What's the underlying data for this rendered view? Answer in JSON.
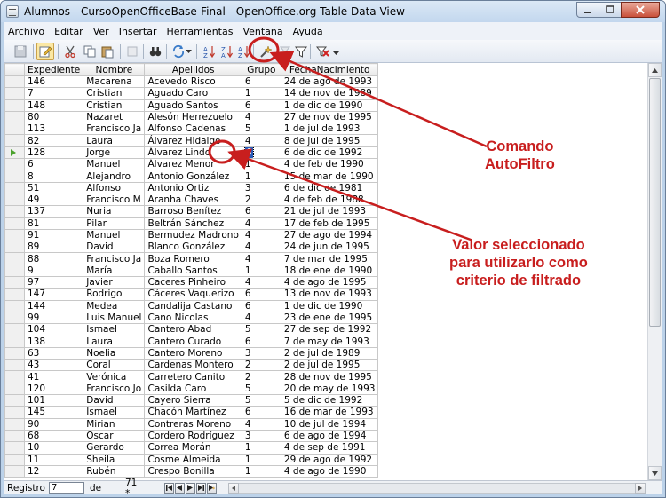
{
  "window": {
    "title": "Alumnos - CursoOpenOfficeBase-Final - OpenOffice.org Table Data View",
    "min": "0",
    "max": "1",
    "close": "r"
  },
  "menu": [
    {
      "u": "A",
      "rest": "rchivo"
    },
    {
      "u": "E",
      "rest": "ditar"
    },
    {
      "u": "V",
      "rest": "er"
    },
    {
      "u": "I",
      "rest": "nsertar"
    },
    {
      "u": "H",
      "rest": "erramientas"
    },
    {
      "u": "V",
      "rest": "entana"
    },
    {
      "u": "Ay",
      "rest": "uda"
    }
  ],
  "columns": [
    "Expediente",
    "Nombre",
    "Apellidos",
    "Grupo",
    "FechaNacimiento"
  ],
  "rows": [
    [
      "146",
      "Macarena",
      "Acevedo Risco",
      "6",
      "24 de ago de 1993"
    ],
    [
      "7",
      "Cristian",
      "Aguado Caro",
      "1",
      "14 de nov de 1989"
    ],
    [
      "148",
      "Cristian",
      "Aguado Santos",
      "6",
      "1 de dic de 1990"
    ],
    [
      "80",
      "Nazaret",
      "Alesón Herrezuelo",
      "4",
      "27 de nov de 1995"
    ],
    [
      "113",
      "Francisco Ja",
      "Alfonso Cadenas",
      "5",
      "1 de jul de 1993"
    ],
    [
      "82",
      "Laura",
      "Álvarez Hidalgo",
      "4",
      "8 de jul de 1995"
    ],
    [
      "128",
      "Jorge",
      "Álvarez Lindo",
      "6",
      "6 de dic de 1992"
    ],
    [
      "6",
      "Manuel",
      "Álvarez Menor",
      "1",
      "4 de feb de 1990"
    ],
    [
      "8",
      "Alejandro",
      "Antonio González",
      "1",
      "15 de mar de 1990"
    ],
    [
      "51",
      "Alfonso",
      "Antonio Ortiz",
      "3",
      "6 de dic de 1981"
    ],
    [
      "49",
      "Francisco M",
      "Aranha Chaves",
      "2",
      "4 de feb de 1988"
    ],
    [
      "137",
      "Nuria",
      "Barroso Benítez",
      "6",
      "21 de jul de 1993"
    ],
    [
      "81",
      "Pilar",
      "Beltrán Sánchez",
      "4",
      "17 de feb de 1995"
    ],
    [
      "91",
      "Manuel",
      "Bermudez Madrono",
      "4",
      "27 de ago de 1994"
    ],
    [
      "89",
      "David",
      "Blanco González",
      "4",
      "24 de jun de 1995"
    ],
    [
      "88",
      "Francisco Ja",
      "Boza Romero",
      "4",
      "7 de mar de 1995"
    ],
    [
      "9",
      "María",
      "Caballo Santos",
      "1",
      "18 de ene de 1990"
    ],
    [
      "97",
      "Javier",
      "Caceres Pinheiro",
      "4",
      "4 de ago de 1995"
    ],
    [
      "147",
      "Rodrigo",
      "Cáceres Vaquerizo",
      "6",
      "13 de nov de 1993"
    ],
    [
      "144",
      "Medea",
      "Candalija Castano",
      "6",
      "1 de dic de 1990"
    ],
    [
      "99",
      "Luis Manuel",
      "Cano Nicolas",
      "4",
      "23 de ene de 1995"
    ],
    [
      "104",
      "Ismael",
      "Cantero Abad",
      "5",
      "27 de sep de 1992"
    ],
    [
      "138",
      "Laura",
      "Cantero Curado",
      "6",
      "7 de may de 1993"
    ],
    [
      "63",
      "Noelia",
      "Cantero Moreno",
      "3",
      "2 de jul de 1989"
    ],
    [
      "43",
      "Coral",
      "Cardenas Montero",
      "2",
      "2 de jul de 1995"
    ],
    [
      "41",
      "Verónica",
      "Carretero Canito",
      "2",
      "28 de nov de 1995"
    ],
    [
      "120",
      "Francisco Jo",
      "Casilda Caro",
      "5",
      "20 de may de 1993"
    ],
    [
      "101",
      "David",
      "Cayero Sierra",
      "5",
      "5 de dic de 1992"
    ],
    [
      "145",
      "Ismael",
      "Chacón Martínez",
      "6",
      "16 de mar de 1993"
    ],
    [
      "90",
      "Mirian",
      "Contreras Moreno",
      "4",
      "10 de jul de 1994"
    ],
    [
      "68",
      "Oscar",
      "Cordero Rodríguez",
      "3",
      "6 de ago de 1994"
    ],
    [
      "10",
      "Gerardo",
      "Correa Morán",
      "1",
      "4 de sep de 1991"
    ],
    [
      "11",
      "Sheila",
      "Cosme Almeida",
      "1",
      "29 de ago de 1992"
    ],
    [
      "12",
      "Rubén",
      "Crespo Bonilla",
      "1",
      "4 de ago de 1990"
    ]
  ],
  "current_row_index": 6,
  "navigation": {
    "label": "Registro",
    "current": "7",
    "of_label": "de",
    "total": "71 *"
  },
  "annotations": {
    "autofilter": [
      "Comando",
      "AutoFiltro"
    ],
    "selected_value": [
      "Valor seleccionado",
      "para utilizarlo como",
      "criterio de filtrado"
    ]
  },
  "colors": {
    "annotation": "#c81e1e",
    "selection": "#2a5bb8"
  }
}
